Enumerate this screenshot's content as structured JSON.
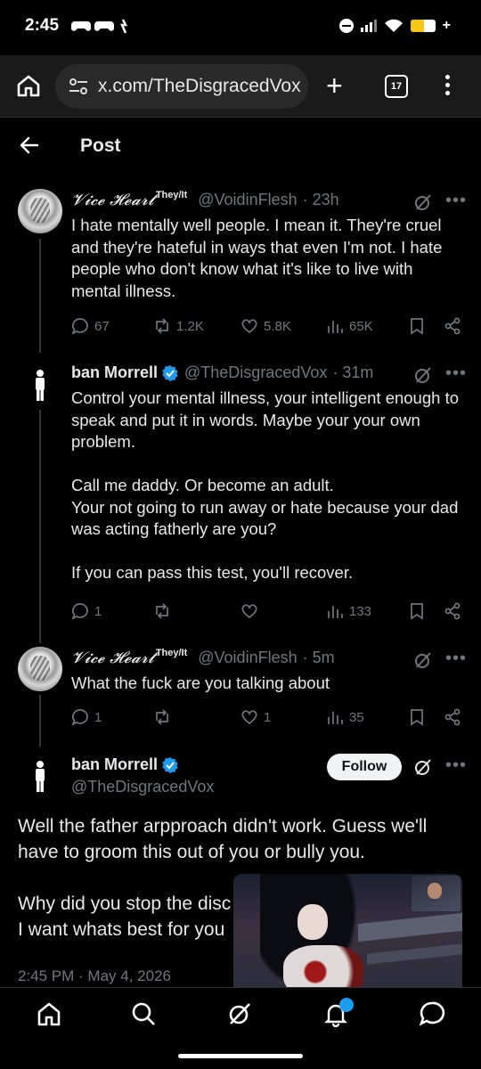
{
  "status_bar": {
    "time": "2:45",
    "battery_level": 0.55
  },
  "browser": {
    "url": "x.com/TheDisgracedVox",
    "tab_count": "17"
  },
  "header": {
    "title": "Post"
  },
  "tweets": [
    {
      "display_name": "𝓥𝓲𝓬𝓮 𝓗𝓮𝓪𝓻𝓽",
      "pronouns": "They/It",
      "handle": "@VoidinFlesh",
      "time": "· 23h",
      "paragraphs": [
        "I hate mentally well people. I mean it. They're cruel and they're hateful in ways that even I'm not. I hate people who don't know what it's like to live with mental illness."
      ],
      "replies": "67",
      "reposts": "1.2K",
      "likes": "5.8K",
      "views": "65K"
    },
    {
      "display_name": "ban Morrell",
      "handle": "@TheDisgracedVox",
      "time": "· 31m",
      "paragraphs": [
        "Control your mental illness, your intelligent enough to speak and put it in words. Maybe your your own problem.",
        "Call me daddy. Or become an adult.\nYour not going to run away or hate because your dad was acting fatherly are you?",
        "If you can pass this test, you'll recover."
      ],
      "replies": "1",
      "reposts": "",
      "likes": "",
      "views": "133"
    },
    {
      "display_name": "𝓥𝓲𝓬𝓮 𝓗𝓮𝓪𝓻𝓽",
      "pronouns": "They/It",
      "handle": "@VoidinFlesh",
      "time": "· 5m",
      "paragraphs": [
        "What the fuck are you talking about"
      ],
      "replies": "1",
      "reposts": "",
      "likes": "1",
      "views": "35"
    }
  ],
  "main_tweet": {
    "display_name": "ban Morrell",
    "handle": "@TheDisgracedVox",
    "follow_label": "Follow",
    "paragraphs": [
      "Well the father arpproach didn't work. Guess we'll have to groom this out of you or bully you.",
      "Why did you stop the disc\nI want whats best for you"
    ],
    "timestamp": "2:45 PM · May 4, 2026"
  },
  "colors": {
    "verified": "#1d9bf0",
    "muted": "#71767b",
    "text": "#e7e9ea"
  }
}
